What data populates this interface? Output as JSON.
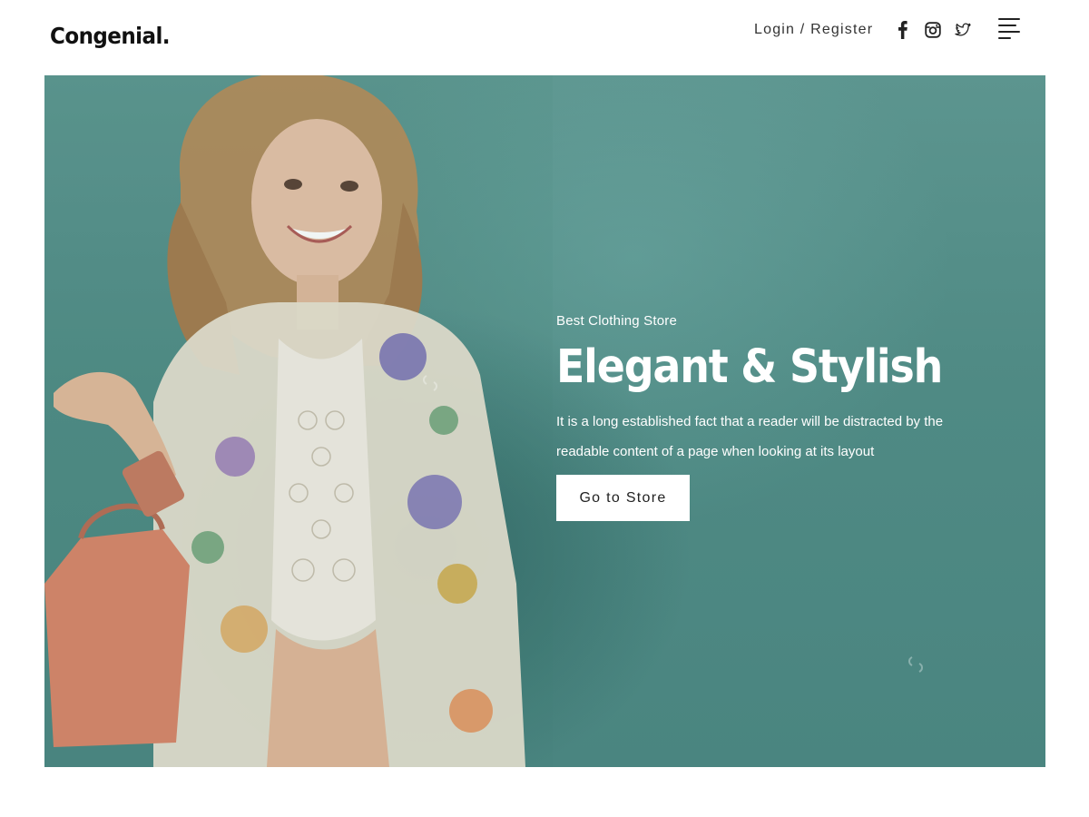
{
  "header": {
    "logo": "Congenial.",
    "auth_link": "Login / Register",
    "social": [
      {
        "icon": "facebook-icon"
      },
      {
        "icon": "instagram-icon"
      },
      {
        "icon": "twitter-icon"
      }
    ],
    "menu_icon": "hamburger-menu-icon"
  },
  "hero": {
    "eyebrow": "Best Clothing Store",
    "title": "Elegant & Stylish",
    "text": "It is a long established fact that a reader will be distracted by the readable content of a page when looking at its layout",
    "cta_label": "Go to Store"
  },
  "colors": {
    "hero_bg": "#4f8a84",
    "text_dark": "#111111",
    "button_bg": "#ffffff"
  }
}
